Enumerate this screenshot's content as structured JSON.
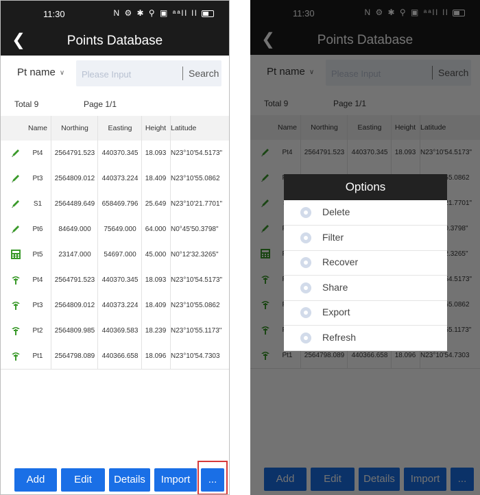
{
  "status": {
    "time": "11:30",
    "icons_text": "N ⚙ ✱ ⚲ ▣ ᵃᵃll ll"
  },
  "title": "Points Database",
  "search": {
    "field_label": "Pt name",
    "placeholder": "Please Input",
    "button": "Search"
  },
  "summary": {
    "total": "Total 9",
    "page": "Page 1/1"
  },
  "columns": [
    "Name",
    "Northing",
    "Easting",
    "Height",
    "Latitude"
  ],
  "rows": [
    {
      "icon": "pencil-icon",
      "name": "Pt4",
      "northing": "2564791.523",
      "easting": "440370.345",
      "height": "18.093",
      "latitude": "N23°10'54.5173\""
    },
    {
      "icon": "pencil-icon",
      "name": "Pt3",
      "northing": "2564809.012",
      "easting": "440373.224",
      "height": "18.409",
      "latitude": "N23°10'55.0862"
    },
    {
      "icon": "pencil-icon",
      "name": "S1",
      "northing": "2564489.649",
      "easting": "658469.796",
      "height": "25.649",
      "latitude": "N23°10'21.7701\""
    },
    {
      "icon": "pencil-icon",
      "name": "Pt6",
      "northing": "84649.000",
      "easting": "75649.000",
      "height": "64.000",
      "latitude": "N0°45'50.3798\""
    },
    {
      "icon": "calculator-icon",
      "name": "Pt5",
      "northing": "23147.000",
      "easting": "54697.000",
      "height": "45.000",
      "latitude": "N0°12'32.3265\""
    },
    {
      "icon": "gps-pole-icon",
      "name": "Pt4",
      "northing": "2564791.523",
      "easting": "440370.345",
      "height": "18.093",
      "latitude": "N23°10'54.5173\""
    },
    {
      "icon": "gps-pole-icon",
      "name": "Pt3",
      "northing": "2564809.012",
      "easting": "440373.224",
      "height": "18.409",
      "latitude": "N23°10'55.0862"
    },
    {
      "icon": "gps-pole-icon",
      "name": "Pt2",
      "northing": "2564809.985",
      "easting": "440369.583",
      "height": "18.239",
      "latitude": "N23°10'55.1173\""
    },
    {
      "icon": "gps-pole-icon",
      "name": "Pt1",
      "northing": "2564798.089",
      "easting": "440366.658",
      "height": "18.096",
      "latitude": "N23°10'54.7303"
    }
  ],
  "buttons": {
    "add": "Add",
    "edit": "Edit",
    "details": "Details",
    "import": "Import",
    "more": "..."
  },
  "options_dialog": {
    "title": "Options",
    "items": [
      "Delete",
      "Filter",
      "Recover",
      "Share",
      "Export",
      "Refresh"
    ]
  },
  "colors": {
    "primary": "#1a6fe6",
    "dark_bar": "#1b1b1b",
    "highlight": "#d63a3a",
    "icon_green": "#3a9a2a"
  }
}
